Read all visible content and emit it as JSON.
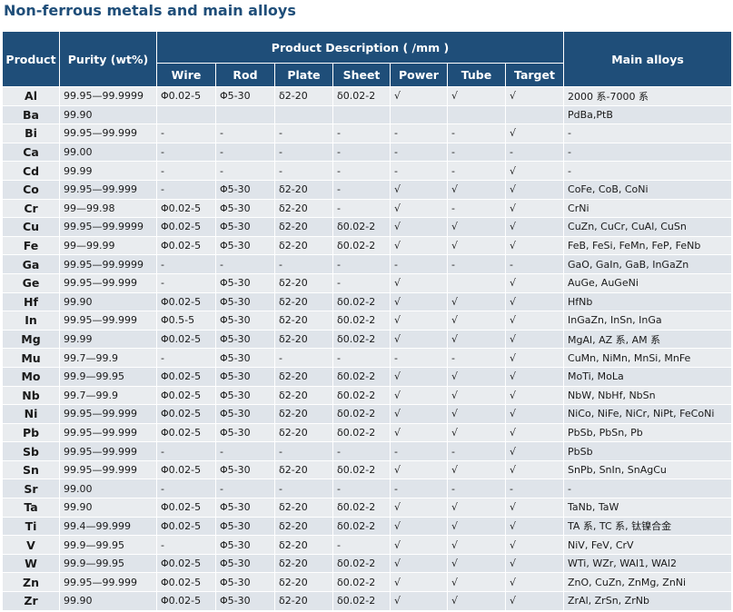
{
  "title": "Non-ferrous metals and main alloys",
  "headers": {
    "product": "Product",
    "purity": "Purity (wt%)",
    "description": "Product Description ( /mm )",
    "wire": "Wire",
    "rod": "Rod",
    "plate": "Plate",
    "sheet": "Sheet",
    "power": "Power",
    "tube": "Tube",
    "target": "Target",
    "alloys": "Main alloys"
  },
  "rows": [
    [
      "Al",
      "99.95—99.9999",
      "Φ0.02-5",
      "Φ5-30",
      "δ2-20",
      "δ0.02-2",
      "√",
      "√",
      "√",
      "2000 系-7000 系"
    ],
    [
      "Ba",
      "99.90",
      "",
      "",
      "",
      "",
      "",
      "",
      "",
      "PdBa,PtB"
    ],
    [
      "Bi",
      "99.95—99.999",
      "-",
      "-",
      "-",
      "-",
      "-",
      "-",
      "√",
      "-"
    ],
    [
      "Ca",
      "99.00",
      "-",
      "-",
      "-",
      "-",
      "-",
      "-",
      "-",
      "-"
    ],
    [
      "Cd",
      "99.99",
      "-",
      "-",
      "-",
      "-",
      "-",
      "-",
      "√",
      "-"
    ],
    [
      "Co",
      "99.95—99.999",
      "-",
      "Φ5-30",
      "δ2-20",
      "-",
      "√",
      "√",
      "√",
      "CoFe, CoB, CoNi"
    ],
    [
      "Cr",
      "99—99.98",
      "Φ0.02-5",
      "Φ5-30",
      "δ2-20",
      "-",
      "√",
      "-",
      "√",
      "CrNi"
    ],
    [
      "Cu",
      "99.95—99.9999",
      "Φ0.02-5",
      "Φ5-30",
      "δ2-20",
      "δ0.02-2",
      "√",
      "√",
      "√",
      "CuZn, CuCr, CuAl, CuSn"
    ],
    [
      "Fe",
      "99—99.99",
      "Φ0.02-5",
      "Φ5-30",
      "δ2-20",
      "δ0.02-2",
      "√",
      "√",
      "√",
      "FeB, FeSi, FeMn, FeP, FeNb"
    ],
    [
      "Ga",
      "99.95—99.9999",
      "-",
      "-",
      "-",
      "-",
      "-",
      "-",
      "-",
      "GaO, GaIn, GaB, InGaZn"
    ],
    [
      "Ge",
      "99.95—99.999",
      "-",
      "Φ5-30",
      "δ2-20",
      "-",
      "√",
      "",
      "√",
      "AuGe, AuGeNi"
    ],
    [
      "Hf",
      "99.90",
      "Φ0.02-5",
      "Φ5-30",
      "δ2-20",
      "δ0.02-2",
      "√",
      "√",
      "√",
      "HfNb"
    ],
    [
      "In",
      "99.95—99.999",
      "Φ0.5-5",
      "Φ5-30",
      "δ2-20",
      "δ0.02-2",
      "√",
      "√",
      "√",
      "InGaZn, InSn, InGa"
    ],
    [
      "Mg",
      "99.99",
      "Φ0.02-5",
      "Φ5-30",
      "δ2-20",
      "δ0.02-2",
      "√",
      "√",
      "√",
      "MgAl, AZ 系, AM 系"
    ],
    [
      "Mu",
      "99.7—99.9",
      "-",
      "Φ5-30",
      "-",
      "-",
      "-",
      "-",
      "√",
      "CuMn, NiMn, MnSi, MnFe"
    ],
    [
      "Mo",
      "99.9—99.95",
      "Φ0.02-5",
      "Φ5-30",
      "δ2-20",
      "δ0.02-2",
      "√",
      "√",
      "√",
      "MoTi, MoLa"
    ],
    [
      "Nb",
      "99.7—99.9",
      "Φ0.02-5",
      "Φ5-30",
      "δ2-20",
      "δ0.02-2",
      "√",
      "√",
      "√",
      "NbW, NbHf, NbSn"
    ],
    [
      "Ni",
      "99.95—99.999",
      "Φ0.02-5",
      "Φ5-30",
      "δ2-20",
      "δ0.02-2",
      "√",
      "√",
      "√",
      "NiCo, NiFe, NiCr, NiPt, FeCoNi"
    ],
    [
      "Pb",
      "99.95—99.999",
      "Φ0.02-5",
      "Φ5-30",
      "δ2-20",
      "δ0.02-2",
      "√",
      "√",
      "√",
      "PbSb, PbSn, Pb"
    ],
    [
      "Sb",
      "99.95—99.999",
      "-",
      "-",
      "-",
      "-",
      "-",
      "-",
      "√",
      "PbSb"
    ],
    [
      "Sn",
      "99.95—99.999",
      "Φ0.02-5",
      "Φ5-30",
      "δ2-20",
      "δ0.02-2",
      "√",
      "√",
      "√",
      "SnPb, SnIn, SnAgCu"
    ],
    [
      "Sr",
      "99.00",
      "-",
      "-",
      "-",
      "-",
      "-",
      "-",
      "-",
      "-"
    ],
    [
      "Ta",
      "99.90",
      "Φ0.02-5",
      "Φ5-30",
      "δ2-20",
      "δ0.02-2",
      "√",
      "√",
      "√",
      "TaNb, TaW"
    ],
    [
      "Ti",
      "99.4—99.999",
      "Φ0.02-5",
      "Φ5-30",
      "δ2-20",
      "δ0.02-2",
      "√",
      "√",
      "√",
      "TA 系, TC 系, 钛镍合金"
    ],
    [
      "V",
      "99.9—99.95",
      "-",
      "Φ5-30",
      "δ2-20",
      "-",
      "√",
      "√",
      "√",
      "NiV, FeV, CrV"
    ],
    [
      "W",
      "99.9—99.95",
      "Φ0.02-5",
      "Φ5-30",
      "δ2-20",
      "δ0.02-2",
      "√",
      "√",
      "√",
      "WTi, WZr, WAl1, WAl2"
    ],
    [
      "Zn",
      "99.95—99.999",
      "Φ0.02-5",
      "Φ5-30",
      "δ2-20",
      "δ0.02-2",
      "√",
      "√",
      "√",
      "ZnO, CuZn, ZnMg, ZnNi"
    ],
    [
      "Zr",
      "99.90",
      "Φ0.02-5",
      "Φ5-30",
      "δ2-20",
      "δ0.02-2",
      "√",
      "√",
      "√",
      "ZrAl, ZrSn, ZrNb"
    ]
  ],
  "colors": {
    "header_bg": "#1f4e79",
    "title": "#1f4e79",
    "row_odd": "#e9ecef",
    "row_even": "#dfe4ea"
  }
}
